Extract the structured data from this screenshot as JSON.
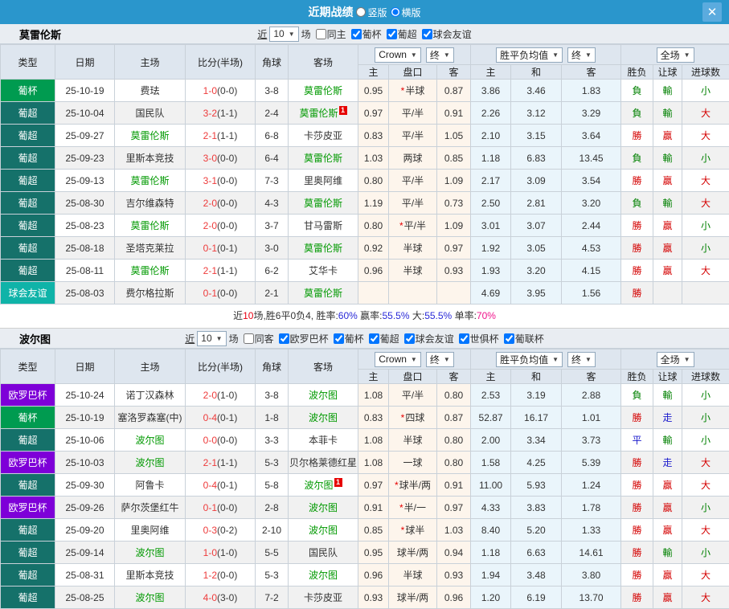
{
  "titlebar": {
    "title": "近期战绩",
    "vertical": "竖版",
    "horizontal": "横版",
    "selected": "横版",
    "close": "✕"
  },
  "header": {
    "type": "类型",
    "date": "日期",
    "home": "主场",
    "score": "比分(半场)",
    "corner": "角球",
    "away": "客场",
    "bookmaker": "Crown",
    "final1": "终",
    "avg": "胜平负均值",
    "final2": "终",
    "scope": "全场",
    "sub_home": "主",
    "sub_handicap": "盘口",
    "sub_away": "客",
    "sub_avg_home": "主",
    "sub_avg_draw": "和",
    "sub_avg_away": "客",
    "wl": "胜负",
    "handicap_result": "让球",
    "goals": "进球数"
  },
  "filter_common": {
    "near": "近",
    "unit": "场"
  },
  "colors": {
    "topbar": "#2A96CC",
    "close_bg": "#5BABDE",
    "team_green": "#009900",
    "score_red": "#EE3B3B",
    "types": {
      "葡杯": "#009B50",
      "葡超": "#15716A",
      "球会友谊": "#0FB3A8",
      "欧罗巴杯": "#7E00D8"
    },
    "result": {
      "r": "#D40000",
      "g": "#008000",
      "b": "#1919CC"
    },
    "summary": {
      "k": "#333333",
      "r": "#E60012",
      "b": "#2828D7",
      "p": "#F0148C"
    }
  },
  "tables": [
    {
      "team": "莫雷伦斯",
      "count": "10",
      "filters": [
        {
          "label": "同主",
          "checked": false
        },
        {
          "label": "葡杯",
          "checked": true
        },
        {
          "label": "葡超",
          "checked": true
        },
        {
          "label": "球会友谊",
          "checked": true
        }
      ],
      "rows": [
        {
          "type": "葡杯",
          "date": "25-10-19",
          "home": "费珐",
          "hg": false,
          "hb": false,
          "score": "1-0",
          "half": "(0-0)",
          "corner": "3-8",
          "away": "莫雷伦斯",
          "ag": true,
          "ab": false,
          "o1": "0.95",
          "star": true,
          "hc": "半球",
          "o2": "0.87",
          "a1": "3.86",
          "a2": "3.46",
          "a3": "1.83",
          "wl": "負",
          "wlc": "g",
          "hr": "輸",
          "hrc": "g",
          "gl": "小",
          "glc": "g"
        },
        {
          "type": "葡超",
          "date": "25-10-04",
          "home": "国民队",
          "hg": false,
          "hb": false,
          "score": "3-2",
          "half": "(1-1)",
          "corner": "2-4",
          "away": "莫雷伦斯",
          "ag": true,
          "ab": true,
          "o1": "0.97",
          "star": false,
          "hc": "平/半",
          "o2": "0.91",
          "a1": "2.26",
          "a2": "3.12",
          "a3": "3.29",
          "wl": "負",
          "wlc": "g",
          "hr": "輸",
          "hrc": "g",
          "gl": "大",
          "glc": "r"
        },
        {
          "type": "葡超",
          "date": "25-09-27",
          "home": "莫雷伦斯",
          "hg": true,
          "hb": false,
          "score": "2-1",
          "half": "(1-1)",
          "corner": "6-8",
          "away": "卡莎皮亚",
          "ag": false,
          "ab": false,
          "o1": "0.83",
          "star": false,
          "hc": "平/半",
          "o2": "1.05",
          "a1": "2.10",
          "a2": "3.15",
          "a3": "3.64",
          "wl": "勝",
          "wlc": "r",
          "hr": "贏",
          "hrc": "r",
          "gl": "大",
          "glc": "r"
        },
        {
          "type": "葡超",
          "date": "25-09-23",
          "home": "里斯本竞技",
          "hg": false,
          "hb": false,
          "score": "3-0",
          "half": "(0-0)",
          "corner": "6-4",
          "away": "莫雷伦斯",
          "ag": true,
          "ab": false,
          "o1": "1.03",
          "star": false,
          "hc": "两球",
          "o2": "0.85",
          "a1": "1.18",
          "a2": "6.83",
          "a3": "13.45",
          "wl": "負",
          "wlc": "g",
          "hr": "輸",
          "hrc": "g",
          "gl": "小",
          "glc": "g"
        },
        {
          "type": "葡超",
          "date": "25-09-13",
          "home": "莫雷伦斯",
          "hg": true,
          "hb": false,
          "score": "3-1",
          "half": "(0-0)",
          "corner": "7-3",
          "away": "里奥阿维",
          "ag": false,
          "ab": false,
          "o1": "0.80",
          "star": false,
          "hc": "平/半",
          "o2": "1.09",
          "a1": "2.17",
          "a2": "3.09",
          "a3": "3.54",
          "wl": "勝",
          "wlc": "r",
          "hr": "贏",
          "hrc": "r",
          "gl": "大",
          "glc": "r"
        },
        {
          "type": "葡超",
          "date": "25-08-30",
          "home": "吉尔维森特",
          "hg": false,
          "hb": false,
          "score": "2-0",
          "half": "(0-0)",
          "corner": "4-3",
          "away": "莫雷伦斯",
          "ag": true,
          "ab": false,
          "o1": "1.19",
          "star": false,
          "hc": "平/半",
          "o2": "0.73",
          "a1": "2.50",
          "a2": "2.81",
          "a3": "3.20",
          "wl": "負",
          "wlc": "g",
          "hr": "輸",
          "hrc": "g",
          "gl": "大",
          "glc": "r"
        },
        {
          "type": "葡超",
          "date": "25-08-23",
          "home": "莫雷伦斯",
          "hg": true,
          "hb": false,
          "score": "2-0",
          "half": "(0-0)",
          "corner": "3-7",
          "away": "甘马雷斯",
          "ag": false,
          "ab": false,
          "o1": "0.80",
          "star": true,
          "hc": "平/半",
          "o2": "1.09",
          "a1": "3.01",
          "a2": "3.07",
          "a3": "2.44",
          "wl": "勝",
          "wlc": "r",
          "hr": "贏",
          "hrc": "r",
          "gl": "小",
          "glc": "g"
        },
        {
          "type": "葡超",
          "date": "25-08-18",
          "home": "圣塔克莱拉",
          "hg": false,
          "hb": false,
          "score": "0-1",
          "half": "(0-1)",
          "corner": "3-0",
          "away": "莫雷伦斯",
          "ag": true,
          "ab": false,
          "o1": "0.92",
          "star": false,
          "hc": "半球",
          "o2": "0.97",
          "a1": "1.92",
          "a2": "3.05",
          "a3": "4.53",
          "wl": "勝",
          "wlc": "r",
          "hr": "贏",
          "hrc": "r",
          "gl": "小",
          "glc": "g"
        },
        {
          "type": "葡超",
          "date": "25-08-11",
          "home": "莫雷伦斯",
          "hg": true,
          "hb": false,
          "score": "2-1",
          "half": "(1-1)",
          "corner": "6-2",
          "away": "艾华卡",
          "ag": false,
          "ab": false,
          "o1": "0.96",
          "star": false,
          "hc": "半球",
          "o2": "0.93",
          "a1": "1.93",
          "a2": "3.20",
          "a3": "4.15",
          "wl": "勝",
          "wlc": "r",
          "hr": "贏",
          "hrc": "r",
          "gl": "大",
          "glc": "r"
        },
        {
          "type": "球会友谊",
          "date": "25-08-03",
          "home": "费尔格拉斯",
          "hg": false,
          "hb": false,
          "score": "0-1",
          "half": "(0-0)",
          "corner": "2-1",
          "away": "莫雷伦斯",
          "ag": true,
          "ab": false,
          "o1": "",
          "star": false,
          "hc": "",
          "o2": "",
          "a1": "4.69",
          "a2": "3.95",
          "a3": "1.56",
          "wl": "勝",
          "wlc": "r",
          "hr": "",
          "hrc": "",
          "gl": "",
          "glc": ""
        }
      ],
      "summary": [
        {
          "t": "近",
          "c": "k"
        },
        {
          "t": "10",
          "c": "r"
        },
        {
          "t": "场,胜6平0负4, 胜率:",
          "c": "k"
        },
        {
          "t": "60%",
          "c": "b"
        },
        {
          "t": " 赢率:",
          "c": "k"
        },
        {
          "t": "55.5%",
          "c": "b"
        },
        {
          "t": " 大:",
          "c": "k"
        },
        {
          "t": "55.5%",
          "c": "b"
        },
        {
          "t": " 单率:",
          "c": "k"
        },
        {
          "t": "70%",
          "c": "p"
        }
      ]
    },
    {
      "team": "波尔图",
      "count": "10",
      "filters": [
        {
          "label": "同客",
          "checked": false
        },
        {
          "label": "欧罗巴杯",
          "checked": true
        },
        {
          "label": "葡杯",
          "checked": true
        },
        {
          "label": "葡超",
          "checked": true
        },
        {
          "label": "球会友谊",
          "checked": true
        },
        {
          "label": "世俱杯",
          "checked": true
        },
        {
          "label": "葡联杯",
          "checked": true
        }
      ],
      "rows": [
        {
          "type": "欧罗巴杯",
          "date": "25-10-24",
          "home": "诺丁汉森林",
          "hg": false,
          "hb": false,
          "score": "2-0",
          "half": "(1-0)",
          "corner": "3-8",
          "away": "波尔图",
          "ag": true,
          "ab": false,
          "o1": "1.08",
          "star": false,
          "hc": "平/半",
          "o2": "0.80",
          "a1": "2.53",
          "a2": "3.19",
          "a3": "2.88",
          "wl": "負",
          "wlc": "g",
          "hr": "輸",
          "hrc": "g",
          "gl": "小",
          "glc": "g"
        },
        {
          "type": "葡杯",
          "date": "25-10-19",
          "home": "塞洛罗森塞(中)",
          "hg": false,
          "hb": false,
          "score": "0-4",
          "half": "(0-1)",
          "corner": "1-8",
          "away": "波尔图",
          "ag": true,
          "ab": false,
          "o1": "0.83",
          "star": true,
          "hc": "四球",
          "o2": "0.87",
          "a1": "52.87",
          "a2": "16.17",
          "a3": "1.01",
          "wl": "勝",
          "wlc": "r",
          "hr": "走",
          "hrc": "b",
          "gl": "小",
          "glc": "g"
        },
        {
          "type": "葡超",
          "date": "25-10-06",
          "home": "波尔图",
          "hg": true,
          "hb": false,
          "score": "0-0",
          "half": "(0-0)",
          "corner": "3-3",
          "away": "本菲卡",
          "ag": false,
          "ab": false,
          "o1": "1.08",
          "star": false,
          "hc": "半球",
          "o2": "0.80",
          "a1": "2.00",
          "a2": "3.34",
          "a3": "3.73",
          "wl": "平",
          "wlc": "b",
          "hr": "輸",
          "hrc": "g",
          "gl": "小",
          "glc": "g"
        },
        {
          "type": "欧罗巴杯",
          "date": "25-10-03",
          "home": "波尔图",
          "hg": true,
          "hb": false,
          "score": "2-1",
          "half": "(1-1)",
          "corner": "5-3",
          "away": "贝尔格莱德红星",
          "ag": false,
          "ab": false,
          "o1": "1.08",
          "star": false,
          "hc": "一球",
          "o2": "0.80",
          "a1": "1.58",
          "a2": "4.25",
          "a3": "5.39",
          "wl": "勝",
          "wlc": "r",
          "hr": "走",
          "hrc": "b",
          "gl": "大",
          "glc": "r"
        },
        {
          "type": "葡超",
          "date": "25-09-30",
          "home": "阿鲁卡",
          "hg": false,
          "hb": false,
          "score": "0-4",
          "half": "(0-1)",
          "corner": "5-8",
          "away": "波尔图",
          "ag": true,
          "ab": true,
          "o1": "0.97",
          "star": true,
          "hc": "球半/两",
          "o2": "0.91",
          "a1": "11.00",
          "a2": "5.93",
          "a3": "1.24",
          "wl": "勝",
          "wlc": "r",
          "hr": "贏",
          "hrc": "r",
          "gl": "大",
          "glc": "r"
        },
        {
          "type": "欧罗巴杯",
          "date": "25-09-26",
          "home": "萨尔茨堡红牛",
          "hg": false,
          "hb": false,
          "score": "0-1",
          "half": "(0-0)",
          "corner": "2-8",
          "away": "波尔图",
          "ag": true,
          "ab": false,
          "o1": "0.91",
          "star": true,
          "hc": "半/一",
          "o2": "0.97",
          "a1": "4.33",
          "a2": "3.83",
          "a3": "1.78",
          "wl": "勝",
          "wlc": "r",
          "hr": "贏",
          "hrc": "r",
          "gl": "小",
          "glc": "g"
        },
        {
          "type": "葡超",
          "date": "25-09-20",
          "home": "里奥阿维",
          "hg": false,
          "hb": false,
          "score": "0-3",
          "half": "(0-2)",
          "corner": "2-10",
          "away": "波尔图",
          "ag": true,
          "ab": false,
          "o1": "0.85",
          "star": true,
          "hc": "球半",
          "o2": "1.03",
          "a1": "8.40",
          "a2": "5.20",
          "a3": "1.33",
          "wl": "勝",
          "wlc": "r",
          "hr": "贏",
          "hrc": "r",
          "gl": "大",
          "glc": "r"
        },
        {
          "type": "葡超",
          "date": "25-09-14",
          "home": "波尔图",
          "hg": true,
          "hb": false,
          "score": "1-0",
          "half": "(1-0)",
          "corner": "5-5",
          "away": "国民队",
          "ag": false,
          "ab": false,
          "o1": "0.95",
          "star": false,
          "hc": "球半/两",
          "o2": "0.94",
          "a1": "1.18",
          "a2": "6.63",
          "a3": "14.61",
          "wl": "勝",
          "wlc": "r",
          "hr": "輸",
          "hrc": "g",
          "gl": "小",
          "glc": "g"
        },
        {
          "type": "葡超",
          "date": "25-08-31",
          "home": "里斯本竞技",
          "hg": false,
          "hb": false,
          "score": "1-2",
          "half": "(0-0)",
          "corner": "5-3",
          "away": "波尔图",
          "ag": true,
          "ab": false,
          "o1": "0.96",
          "star": false,
          "hc": "半球",
          "o2": "0.93",
          "a1": "1.94",
          "a2": "3.48",
          "a3": "3.80",
          "wl": "勝",
          "wlc": "r",
          "hr": "贏",
          "hrc": "r",
          "gl": "大",
          "glc": "r"
        },
        {
          "type": "葡超",
          "date": "25-08-25",
          "home": "波尔图",
          "hg": true,
          "hb": false,
          "score": "4-0",
          "half": "(3-0)",
          "corner": "7-2",
          "away": "卡莎皮亚",
          "ag": false,
          "ab": false,
          "o1": "0.93",
          "star": false,
          "hc": "球半/两",
          "o2": "0.96",
          "a1": "1.20",
          "a2": "6.19",
          "a3": "13.70",
          "wl": "勝",
          "wlc": "r",
          "hr": "贏",
          "hrc": "r",
          "gl": "大",
          "glc": "r"
        }
      ]
    }
  ]
}
